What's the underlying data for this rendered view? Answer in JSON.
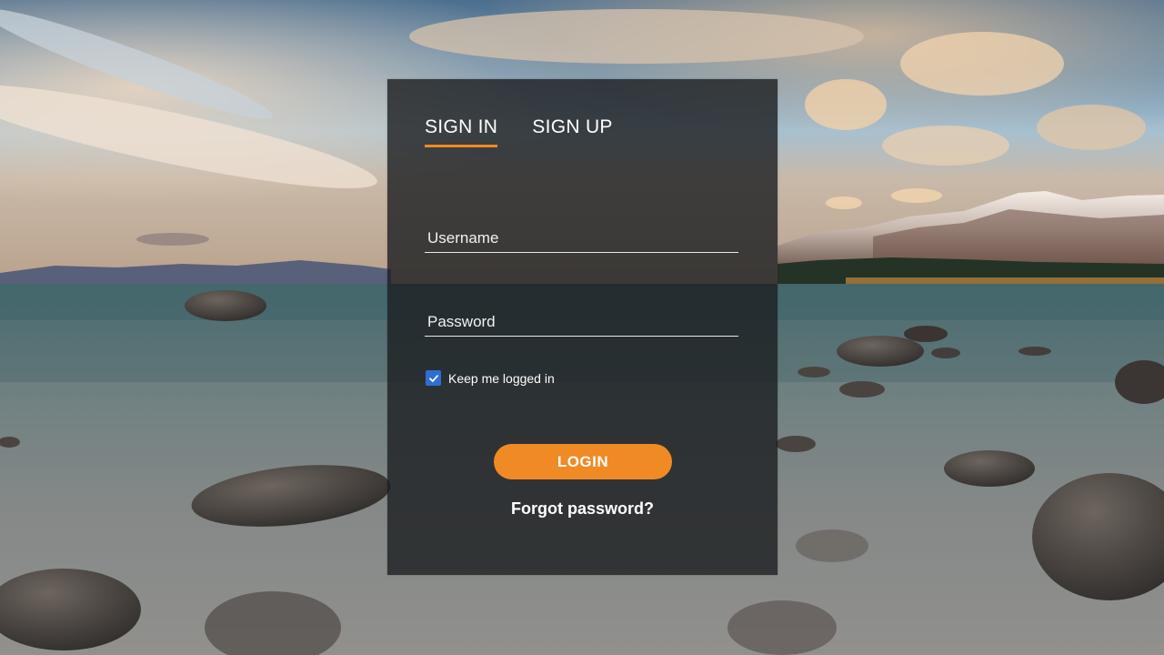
{
  "tabs": [
    {
      "label": "SIGN IN",
      "active": true
    },
    {
      "label": "SIGN UP",
      "active": false
    }
  ],
  "form": {
    "username_placeholder": "Username",
    "username_value": "",
    "password_placeholder": "Password",
    "password_value": "",
    "remember_label": "Keep me logged in",
    "remember_checked": true,
    "login_label": "LOGIN",
    "forgot_label": "Forgot password?"
  },
  "background": {
    "description_icon": "lake-mountain-landscape"
  },
  "colors": {
    "accent": "#f08a24",
    "checkbox": "#2f6ed3",
    "panel": "#1c1e21"
  }
}
